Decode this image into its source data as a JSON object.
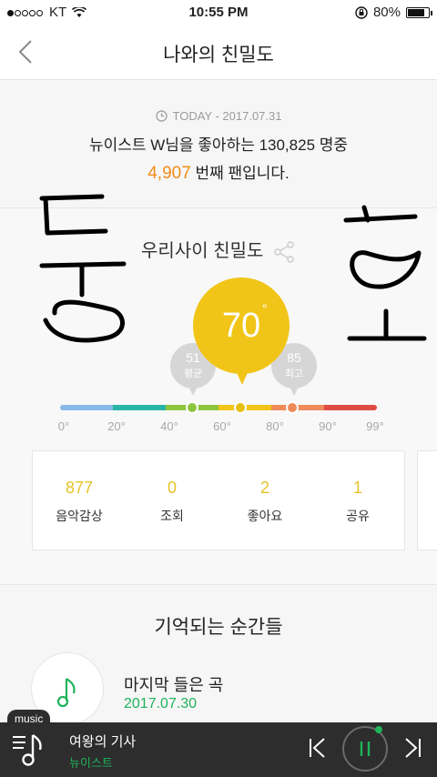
{
  "status": {
    "carrier": "KT",
    "time": "10:55 PM",
    "battery": "80%",
    "battery_level": 0.8
  },
  "header": {
    "title": "나와의 친밀도"
  },
  "today": {
    "date": "TODAY - 2017.07.31",
    "line1": "뉴이스트 W님을 좋아하는 130,825 명중",
    "rank": "4,907",
    "line2_suffix": " 번째 팬입니다."
  },
  "intimacy": {
    "title": "우리사이 친밀도",
    "value": "70",
    "degree": "°",
    "average": {
      "value": "51",
      "label": "평균"
    },
    "best": {
      "value": "85",
      "label": "최고"
    },
    "scale_ticks": [
      "0°",
      "20°",
      "40°",
      "60°",
      "80°",
      "90°",
      "99°"
    ],
    "scale_colors": [
      "#8ab8e8",
      "#29b6a8",
      "#8cc63e",
      "#f1c518",
      "#ef8a5a",
      "#e04c44"
    ]
  },
  "stats": [
    {
      "value": "877",
      "label": "음악감상"
    },
    {
      "value": "0",
      "label": "조회"
    },
    {
      "value": "2",
      "label": "좋아요"
    },
    {
      "value": "1",
      "label": "공유"
    }
  ],
  "memories": {
    "heading": "기억되는 순간들",
    "item_title": "마지막 들은 곡",
    "item_date": "2017.07.30"
  },
  "player": {
    "tag": "music",
    "song": "여왕의 기사",
    "artist": "뉴이스트"
  },
  "colors": {
    "accent_green": "#1fb35a",
    "accent_orange": "#f08c16",
    "accent_yellow": "#f1c518"
  }
}
